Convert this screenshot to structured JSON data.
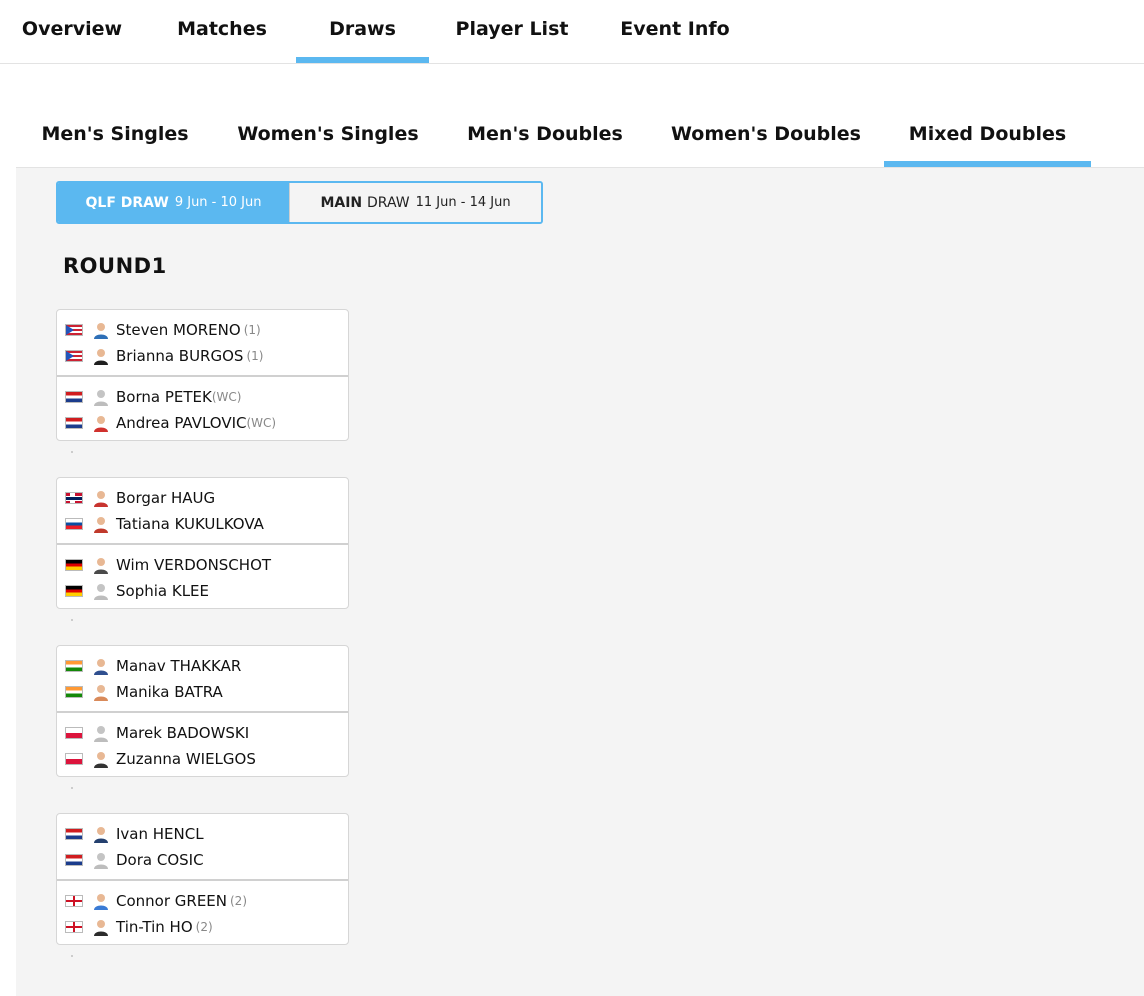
{
  "top_nav": {
    "tabs": [
      {
        "label": "Overview",
        "active": false
      },
      {
        "label": "Matches",
        "active": false
      },
      {
        "label": "Draws",
        "active": true
      },
      {
        "label": "Player List",
        "active": false
      },
      {
        "label": "Event Info",
        "active": false
      }
    ]
  },
  "event_tabs": [
    {
      "label": "Men's Singles",
      "active": false
    },
    {
      "label": "Women's Singles",
      "active": false
    },
    {
      "label": "Men's Doubles",
      "active": false
    },
    {
      "label": "Women's Doubles",
      "active": false
    },
    {
      "label": "Mixed Doubles",
      "active": true
    }
  ],
  "draw_toggle": {
    "qlf": {
      "name": "QLF",
      "suffix": "DRAW",
      "dates": "9 Jun - 10 Jun",
      "active": true
    },
    "main": {
      "name": "MAIN",
      "suffix": "DRAW",
      "dates": "11 Jun - 14 Jun",
      "active": false
    }
  },
  "round_title": "ROUND1",
  "matches": [
    {
      "teams": [
        {
          "players": [
            {
              "name": "Steven MORENO",
              "seed": "(1)",
              "flag": "PR"
            },
            {
              "name": "Brianna BURGOS",
              "seed": "(1)",
              "flag": "PR"
            }
          ]
        },
        {
          "players": [
            {
              "name": "Borna PETEK",
              "seed": "(WC)",
              "flag": "HR"
            },
            {
              "name": "Andrea PAVLOVIC",
              "seed": "(WC)",
              "flag": "HR"
            }
          ]
        }
      ]
    },
    {
      "teams": [
        {
          "players": [
            {
              "name": "Borgar HAUG",
              "seed": "",
              "flag": "NO"
            },
            {
              "name": "Tatiana KUKULKOVA",
              "seed": "",
              "flag": "SK"
            }
          ]
        },
        {
          "players": [
            {
              "name": "Wim VERDONSCHOT",
              "seed": "",
              "flag": "DE"
            },
            {
              "name": "Sophia KLEE",
              "seed": "",
              "flag": "DE"
            }
          ]
        }
      ]
    },
    {
      "teams": [
        {
          "players": [
            {
              "name": "Manav THAKKAR",
              "seed": "",
              "flag": "IN"
            },
            {
              "name": "Manika BATRA",
              "seed": "",
              "flag": "IN"
            }
          ]
        },
        {
          "players": [
            {
              "name": "Marek BADOWSKI",
              "seed": "",
              "flag": "PL"
            },
            {
              "name": "Zuzanna WIELGOS",
              "seed": "",
              "flag": "PL"
            }
          ]
        }
      ]
    },
    {
      "teams": [
        {
          "players": [
            {
              "name": "Ivan HENCL",
              "seed": "",
              "flag": "HR"
            },
            {
              "name": "Dora COSIC",
              "seed": "",
              "flag": "HR"
            }
          ]
        },
        {
          "players": [
            {
              "name": "Connor GREEN",
              "seed": "(2)",
              "flag": "EN"
            },
            {
              "name": "Tin-Tin HO",
              "seed": "(2)",
              "flag": "EN"
            }
          ]
        }
      ]
    }
  ],
  "avatar_colors": [
    "#2e6fb7",
    "#1f1f1f",
    "#bdbdbd",
    "#d0312d",
    "#c8342f",
    "#c0392b",
    "#4a4a4a",
    "#bdbdbd",
    "#2f4f8f",
    "#d98a5a",
    "#bdbdbd",
    "#333333",
    "#24406e",
    "#bdbdbd",
    "#3a7bd5",
    "#2b2b2b"
  ],
  "colors": {
    "accent": "#5bb8f0",
    "background": "#f4f4f4"
  }
}
